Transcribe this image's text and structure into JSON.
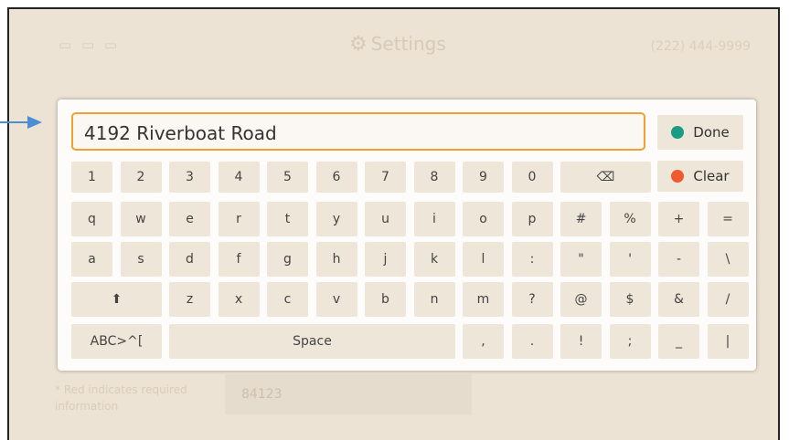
{
  "background": {
    "icons": "▭ ▭ ▭",
    "title": "Settings",
    "phone": "(222) 444-9999",
    "note": "* Red indicates required information",
    "field_value": "84123"
  },
  "keyboard": {
    "input_value": "4192 Riverboat Road",
    "row1": [
      "1",
      "2",
      "3",
      "4",
      "5",
      "6",
      "7",
      "8",
      "9",
      "0"
    ],
    "row2": [
      "q",
      "w",
      "e",
      "r",
      "t",
      "y",
      "u",
      "i",
      "o",
      "p",
      "#",
      "%",
      "+",
      "="
    ],
    "row3": [
      "a",
      "s",
      "d",
      "f",
      "g",
      "h",
      "j",
      "k",
      "l",
      ":",
      "\"",
      "'",
      "-",
      "\\"
    ],
    "row4": [
      "z",
      "x",
      "c",
      "v",
      "b",
      "n",
      "m",
      "?",
      "@",
      "$",
      "&",
      "/"
    ],
    "mode_label": "ABC>^[",
    "space_label": "Space",
    "row5": [
      ",",
      ".",
      "!",
      ";",
      "_",
      "|"
    ],
    "done_label": "Done",
    "clear_label": "Clear"
  },
  "colors": {
    "done": "#1a9c84",
    "clear": "#ee5a30",
    "focus": "#f0a030",
    "arrow": "#4a8fd3"
  }
}
